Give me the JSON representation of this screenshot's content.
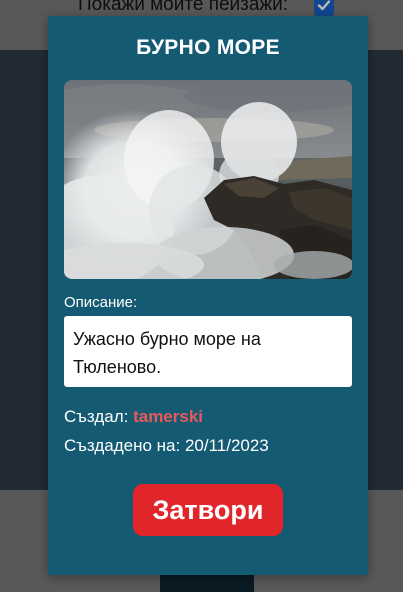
{
  "background": {
    "show_my_landscapes_label": "Покажи моите пейзажи:",
    "show_my_landscapes_checked": true
  },
  "modal": {
    "title": "БУРНО МОРЕ",
    "image_alt": "waves crashing on rocks",
    "description_label": "Описание:",
    "description_text": "Ужасно бурно море на Тюленово.",
    "created_by_label": "Създал:",
    "created_by_value": "tamerski",
    "created_on_label": "Създадено на:",
    "created_on_value": "20/11/2023",
    "close_label": "Затвори"
  },
  "colors": {
    "modal_bg": "#155a73",
    "close_button": "#e0262a",
    "creator_name": "#e85a5a",
    "checkbox": "#1a63c9"
  }
}
